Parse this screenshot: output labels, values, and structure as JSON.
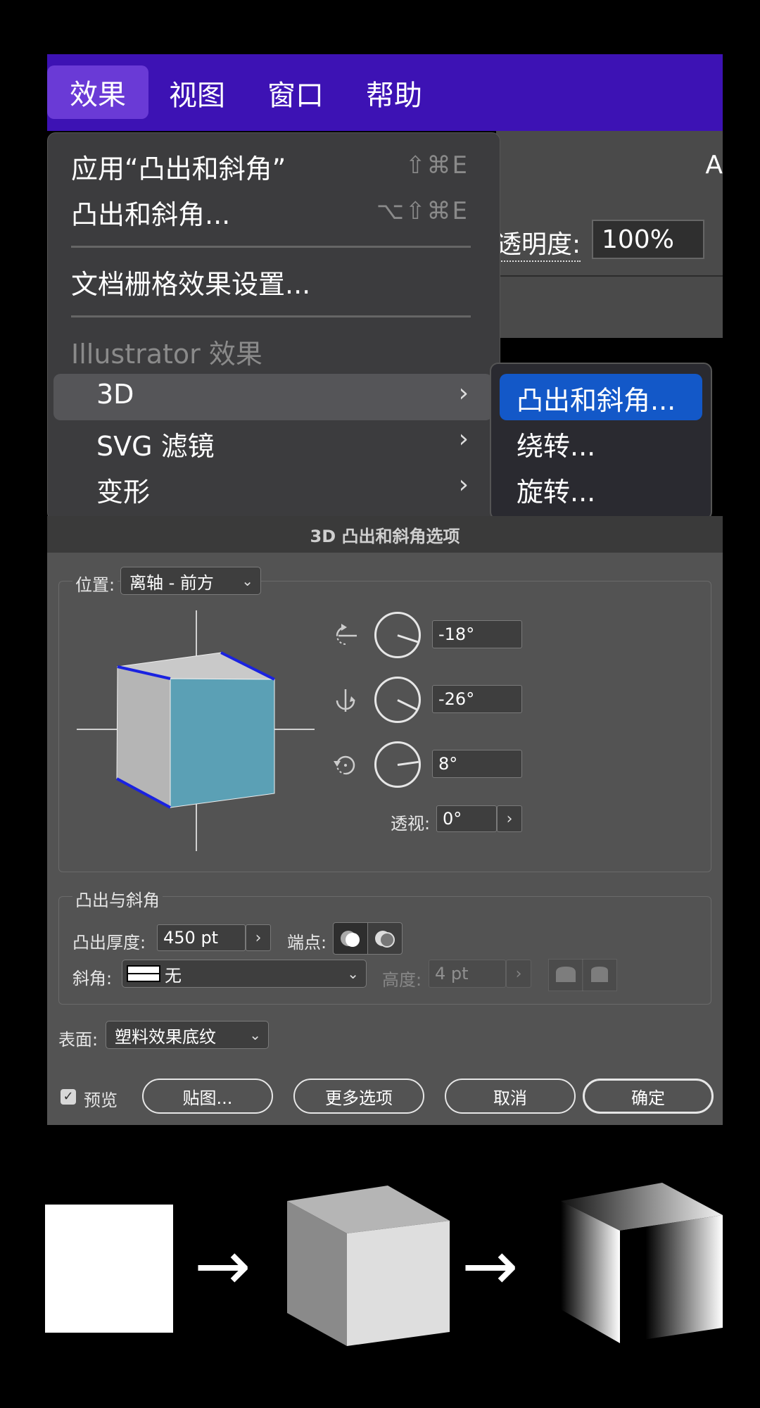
{
  "menubar": {
    "items": [
      "效果",
      "视图",
      "窗口",
      "帮助"
    ],
    "active_color": "#6a3ad6",
    "bar_color": "#3d12b4"
  },
  "background_panel": {
    "tab_letter": "A",
    "opacity_label": "透明度:",
    "opacity_value": "100%"
  },
  "effect_menu": {
    "apply_last": {
      "label": "应用“凸出和斜角”",
      "shortcut": "⇧⌘E"
    },
    "last_effect": {
      "label": "凸出和斜角...",
      "shortcut": "⌥⇧⌘E"
    },
    "raster_settings": "文档栅格效果设置...",
    "section_header": "Illustrator 效果",
    "items": [
      {
        "label": "3D",
        "has_submenu": true,
        "highlighted": true
      },
      {
        "label": "SVG 滤镜",
        "has_submenu": true
      },
      {
        "label": "变形",
        "has_submenu": true
      }
    ],
    "submenu_chevron": "›"
  },
  "submenu_3d": {
    "items": [
      "凸出和斜角...",
      "绕转...",
      "旋转..."
    ],
    "selected_index": 0,
    "selected_color": "#1358c8"
  },
  "dialog": {
    "title": "3D 凸出和斜角选项",
    "position": {
      "label": "位置:",
      "value": "离轴 - 前方"
    },
    "rotation": {
      "x": {
        "value": "-18°",
        "icon": "rotate-x-axis-icon"
      },
      "y": {
        "value": "-26°",
        "icon": "rotate-y-axis-icon"
      },
      "z": {
        "value": "8°",
        "icon": "rotate-z-axis-icon"
      }
    },
    "perspective": {
      "label": "透视:",
      "value": "0°",
      "button": "›"
    },
    "extrude_group": {
      "title": "凸出与斜角",
      "depth_label": "凸出厚度:",
      "depth_value": "450 pt",
      "depth_button": "›",
      "cap_label": "端点:",
      "bevel_label": "斜角:",
      "bevel_value": "无",
      "height_label": "高度:",
      "height_value": "4 pt",
      "height_button": "›"
    },
    "surface": {
      "label": "表面:",
      "value": "塑料效果底纹"
    },
    "preview": {
      "label": "预览",
      "checked": true
    },
    "buttons": {
      "map": "贴图...",
      "more_options": "更多选项",
      "cancel": "取消",
      "ok": "确定"
    },
    "cube_face_color": "#5ba0b5",
    "edge_color": "#1a22e0"
  },
  "illustration": {
    "arrow": "→"
  }
}
